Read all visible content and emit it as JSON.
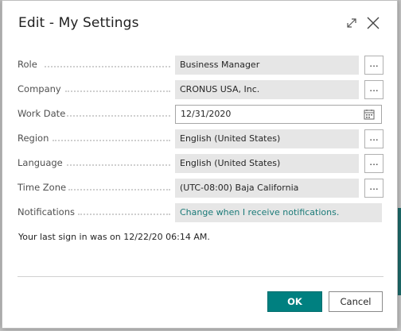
{
  "dialog": {
    "title": "Edit - My Settings"
  },
  "fields": {
    "role": {
      "label": "Role",
      "value": "Business Manager",
      "action": "..."
    },
    "company": {
      "label": "Company",
      "value": "CRONUS USA, Inc.",
      "action": "..."
    },
    "work_date": {
      "label": "Work Date",
      "value": "12/31/2020"
    },
    "region": {
      "label": "Region",
      "value": "English (United States)",
      "action": "..."
    },
    "language": {
      "label": "Language",
      "value": "English (United States)",
      "action": "..."
    },
    "time_zone": {
      "label": "Time Zone",
      "value": "(UTC-08:00) Baja California",
      "action": "..."
    },
    "notifications": {
      "label": "Notifications",
      "value": "Change when I receive notifications."
    }
  },
  "last_sign_in": "Your last sign in was on 12/22/20 06:14 AM.",
  "buttons": {
    "ok": "OK",
    "cancel": "Cancel"
  },
  "colors": {
    "accent": "#008080",
    "link": "#1b7a78",
    "field_bg": "#e6e6e6"
  },
  "icons": [
    "expand-icon",
    "close-icon",
    "calendar-icon"
  ]
}
